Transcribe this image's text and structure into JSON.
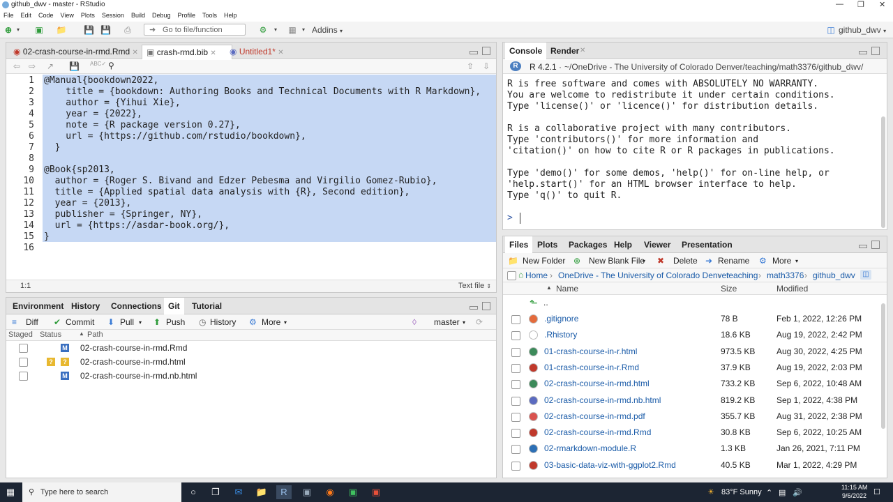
{
  "window": {
    "title": "github_dwv - master - RStudio"
  },
  "menu": [
    "File",
    "Edit",
    "Code",
    "View",
    "Plots",
    "Session",
    "Build",
    "Debug",
    "Profile",
    "Tools",
    "Help"
  ],
  "toolbar": {
    "goto_placeholder": "Go to file/function",
    "addins": "Addins",
    "project": "github_dwv"
  },
  "editor": {
    "tabs": [
      {
        "label": "02-crash-course-in-rmd.Rmd"
      },
      {
        "label": "crash-rmd.bib"
      },
      {
        "label": "Untitled1*"
      }
    ],
    "lines": [
      "@Manual{bookdown2022,",
      "    title = {bookdown: Authoring Books and Technical Documents with R Markdown},",
      "    author = {Yihui Xie},",
      "    year = {2022},",
      "    note = {R package version 0.27},",
      "    url = {https://github.com/rstudio/bookdown},",
      "  }",
      "",
      "@Book{sp2013,",
      "  author = {Roger S. Bivand and Edzer Pebesma and Virgilio Gomez-Rubio},",
      "  title = {Applied spatial data analysis with {R}, Second edition},",
      "  year = {2013},",
      "  publisher = {Springer, NY},",
      "  url = {https://asdar-book.org/},",
      "}",
      ""
    ],
    "line_numbers": [
      "1",
      "2",
      "3",
      "4",
      "5",
      "6",
      "7",
      "8",
      "9",
      "10",
      "11",
      "12",
      "13",
      "14",
      "15",
      "16"
    ],
    "cursor": "1:1",
    "filetype": "Text file"
  },
  "console": {
    "tabs": [
      "Console",
      "Render"
    ],
    "version": "R 4.2.1",
    "path": "~/OneDrive - The University of Colorado Denver/teaching/math3376/github_dwv/",
    "lines": [
      "R is free software and comes with ABSOLUTELY NO WARRANTY.",
      "You are welcome to redistribute it under certain conditions.",
      "Type 'license()' or 'licence()' for distribution details.",
      "",
      "R is a collaborative project with many contributors.",
      "Type 'contributors()' for more information and",
      "'citation()' on how to cite R or R packages in publications.",
      "",
      "Type 'demo()' for some demos, 'help()' for on-line help, or",
      "'help.start()' for an HTML browser interface to help.",
      "Type 'q()' to quit R."
    ],
    "prompt": ">"
  },
  "env": {
    "tabs": [
      "Environment",
      "History",
      "Connections",
      "Git",
      "Tutorial"
    ],
    "toolbar": {
      "diff": "Diff",
      "commit": "Commit",
      "pull": "Pull",
      "push": "Push",
      "history": "History",
      "more": "More",
      "branch": "master"
    },
    "headers": {
      "staged": "Staged",
      "status": "Status",
      "path": "Path"
    },
    "rows": [
      {
        "status": "M",
        "path": "02-crash-course-in-rmd.Rmd"
      },
      {
        "status": "?",
        "path": "02-crash-course-in-rmd.html"
      },
      {
        "status": "M",
        "path": "02-crash-course-in-rmd.nb.html"
      }
    ]
  },
  "files": {
    "tabs": [
      "Files",
      "Plots",
      "Packages",
      "Help",
      "Viewer",
      "Presentation"
    ],
    "toolbar": {
      "new_folder": "New Folder",
      "new_blank": "New Blank File",
      "delete": "Delete",
      "rename": "Rename",
      "more": "More"
    },
    "breadcrumb": [
      "Home",
      "OneDrive - The University of Colorado Denver",
      "teaching",
      "math3376",
      "github_dwv"
    ],
    "headers": {
      "name": "Name",
      "size": "Size",
      "modified": "Modified"
    },
    "up": "..",
    "rows": [
      {
        "name": ".gitignore",
        "size": "78 B",
        "modified": "Feb 1, 2022, 12:26 PM",
        "icon": "#e46b3c"
      },
      {
        "name": ".Rhistory",
        "size": "18.6 KB",
        "modified": "Aug 19, 2022, 2:42 PM",
        "icon": "#ffffff"
      },
      {
        "name": "01-crash-course-in-r.html",
        "size": "973.5 KB",
        "modified": "Aug 30, 2022, 4:25 PM",
        "icon": "#3c8a5a"
      },
      {
        "name": "01-crash-course-in-r.Rmd",
        "size": "37.9 KB",
        "modified": "Aug 19, 2022, 2:03 PM",
        "icon": "#c0392b"
      },
      {
        "name": "02-crash-course-in-rmd.html",
        "size": "733.2 KB",
        "modified": "Sep 6, 2022, 10:48 AM",
        "icon": "#3c8a5a"
      },
      {
        "name": "02-crash-course-in-rmd.nb.html",
        "size": "819.2 KB",
        "modified": "Sep 1, 2022, 4:38 PM",
        "icon": "#5b6bc0"
      },
      {
        "name": "02-crash-course-in-rmd.pdf",
        "size": "355.7 KB",
        "modified": "Aug 31, 2022, 2:38 PM",
        "icon": "#d9534f"
      },
      {
        "name": "02-crash-course-in-rmd.Rmd",
        "size": "30.8 KB",
        "modified": "Sep 6, 2022, 10:25 AM",
        "icon": "#c0392b"
      },
      {
        "name": "02-rmarkdown-module.R",
        "size": "1.3 KB",
        "modified": "Jan 26, 2021, 7:11 PM",
        "icon": "#2c6fb5"
      },
      {
        "name": "03-basic-data-viz-with-ggplot2.Rmd",
        "size": "40.5 KB",
        "modified": "Mar 1, 2022, 4:29 PM",
        "icon": "#c0392b"
      }
    ]
  },
  "taskbar": {
    "search": "Type here to search",
    "weather": "83°F  Sunny",
    "time": "11:15 AM",
    "date": "9/6/2022"
  }
}
